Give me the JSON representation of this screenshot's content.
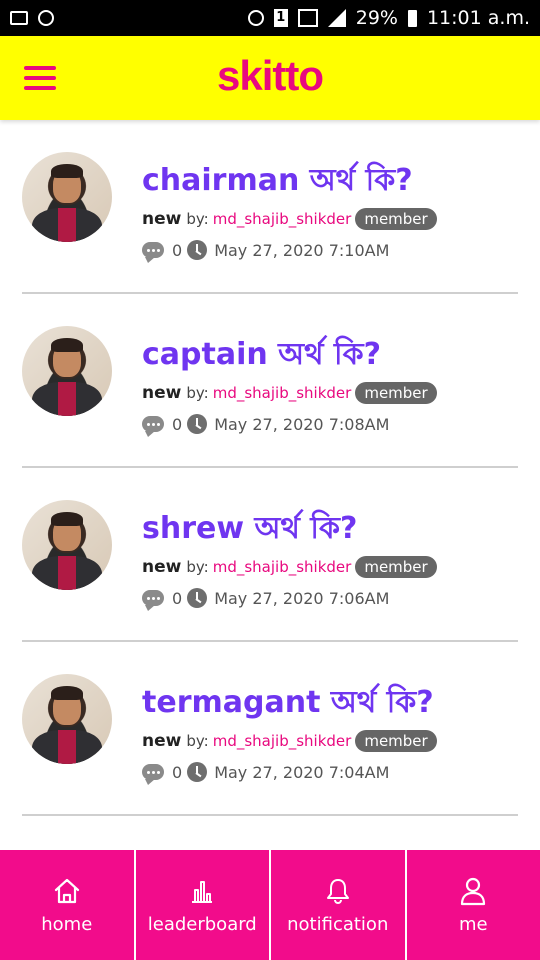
{
  "status_bar": {
    "battery": "29%",
    "time": "11:01 a.m.",
    "sim": "1"
  },
  "header": {
    "logo": "skitto"
  },
  "posts": [
    {
      "title": "chairman অর্থ কি?",
      "status": "new",
      "by_label": "by:",
      "author": "md_shajib_shikder",
      "role": "member",
      "comments": "0",
      "timestamp": "May 27, 2020 7:10AM"
    },
    {
      "title": "captain অর্থ কি?",
      "status": "new",
      "by_label": "by:",
      "author": "md_shajib_shikder",
      "role": "member",
      "comments": "0",
      "timestamp": "May 27, 2020 7:08AM"
    },
    {
      "title": "shrew অর্থ কি?",
      "status": "new",
      "by_label": "by:",
      "author": "md_shajib_shikder",
      "role": "member",
      "comments": "0",
      "timestamp": "May 27, 2020 7:06AM"
    },
    {
      "title": "termagant অর্থ কি?",
      "status": "new",
      "by_label": "by:",
      "author": "md_shajib_shikder",
      "role": "member",
      "comments": "0",
      "timestamp": "May 27, 2020 7:04AM"
    }
  ],
  "bottom_nav": {
    "home": {
      "label": "home",
      "icon": "home-icon"
    },
    "leaderboard": {
      "label": "leaderboard",
      "icon": "bar-chart-icon"
    },
    "notification": {
      "label": "notification",
      "icon": "bell-icon"
    },
    "me": {
      "label": "me",
      "icon": "user-icon"
    }
  },
  "colors": {
    "header_bg": "#ffff00",
    "brand": "#e8097f",
    "title": "#6f35f0",
    "nav_bg": "#f20c8b"
  }
}
